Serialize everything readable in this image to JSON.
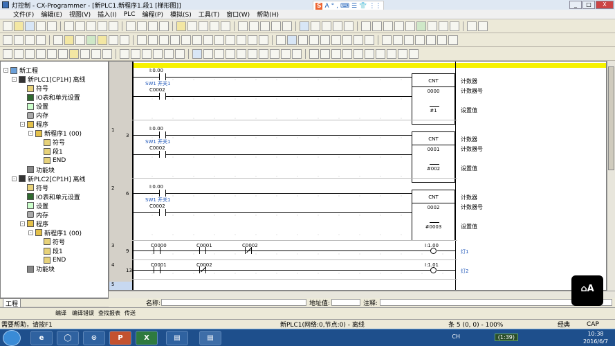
{
  "window": {
    "title": "灯控制 - CX-Programmer - [新PLC1.新程序1.段1 [梯形图]]",
    "controls": [
      "_",
      "□",
      "X"
    ]
  },
  "ime": {
    "logo": "S",
    "items": [
      "A",
      "°",
      ",",
      "⌨",
      "☰",
      "👕",
      "⋮⋮"
    ]
  },
  "menu": {
    "items": [
      "文件(F)",
      "编辑(E)",
      "视图(V)",
      "插入(I)",
      "PLC",
      "编程(P)",
      "模拟(S)",
      "工具(T)",
      "窗口(W)",
      "帮助(H)"
    ]
  },
  "tree": {
    "nodes": [
      {
        "label": "新工程",
        "icon": "project-icon",
        "level": 0,
        "expander": "-"
      },
      {
        "label": "新PLC1[CP1H] 离线",
        "icon": "plc-icon",
        "level": 1,
        "expander": "-"
      },
      {
        "label": "符号",
        "icon": "symbol-icon",
        "level": 2,
        "expander": ""
      },
      {
        "label": "IO表和单元设置",
        "icon": "io-table-icon",
        "level": 2,
        "expander": ""
      },
      {
        "label": "设置",
        "icon": "settings-icon",
        "level": 2,
        "expander": ""
      },
      {
        "label": "内存",
        "icon": "memory-icon",
        "level": 2,
        "expander": ""
      },
      {
        "label": "程序",
        "icon": "program-icon",
        "level": 2,
        "expander": "-"
      },
      {
        "label": "新程序1 (00)",
        "icon": "program-icon",
        "level": 3,
        "expander": "-"
      },
      {
        "label": "符号",
        "icon": "symbol-icon",
        "level": 4,
        "expander": ""
      },
      {
        "label": "段1",
        "icon": "section-icon",
        "level": 4,
        "expander": ""
      },
      {
        "label": "END",
        "icon": "section-icon",
        "level": 4,
        "expander": ""
      },
      {
        "label": "功能块",
        "icon": "function-block-icon",
        "level": 2,
        "expander": ""
      },
      {
        "label": "新PLC2[CP1H] 离线",
        "icon": "plc-icon",
        "level": 1,
        "expander": "-"
      },
      {
        "label": "符号",
        "icon": "symbol-icon",
        "level": 2,
        "expander": ""
      },
      {
        "label": "IO表和单元设置",
        "icon": "io-table-icon",
        "level": 2,
        "expander": ""
      },
      {
        "label": "设置",
        "icon": "settings-icon",
        "level": 2,
        "expander": ""
      },
      {
        "label": "内存",
        "icon": "memory-icon",
        "level": 2,
        "expander": ""
      },
      {
        "label": "程序",
        "icon": "program-icon",
        "level": 2,
        "expander": "-"
      },
      {
        "label": "新程序1 (00)",
        "icon": "program-icon",
        "level": 3,
        "expander": "-"
      },
      {
        "label": "符号",
        "icon": "symbol-icon",
        "level": 4,
        "expander": ""
      },
      {
        "label": "段1",
        "icon": "section-icon",
        "level": 4,
        "expander": ""
      },
      {
        "label": "END",
        "icon": "section-icon",
        "level": 4,
        "expander": ""
      },
      {
        "label": "功能块",
        "icon": "function-block-icon",
        "level": 2,
        "expander": ""
      }
    ],
    "tab_label": "工程"
  },
  "ladder": {
    "rungs": [
      {
        "rung": "",
        "step": "",
        "contact1_addr": "I:0.00",
        "contact1_comment": "SW1 开关1",
        "contact2_addr": "C0002",
        "block_name": "CNT",
        "block_num": "0000",
        "block_set": "#1",
        "label_counter": "计数器",
        "label_counter_no": "计数器号",
        "label_set": "设置值"
      },
      {
        "rung": "1",
        "step": "3",
        "contact1_addr": "I:0.00",
        "contact1_comment": "SW1 开关1",
        "contact2_addr": "C0002",
        "block_name": "CNT",
        "block_num": "0001",
        "block_set": "#002",
        "label_counter": "计数器",
        "label_counter_no": "计数器号",
        "label_set": "设置值"
      },
      {
        "rung": "2",
        "step": "6",
        "contact1_addr": "I:0.00",
        "contact1_comment": "SW1 开关1",
        "contact2_addr": "C0002",
        "block_name": "CNT",
        "block_num": "0002",
        "block_set": "#0003",
        "label_counter": "计数器",
        "label_counter_no": "计数器号",
        "label_set": "设置值"
      }
    ],
    "rung3": {
      "rung": "3",
      "step": "9",
      "c1": "C0000",
      "c2": "C0001",
      "c3": "C0002",
      "coil_addr": "I:1.00",
      "coil_comment": "灯1"
    },
    "rung4": {
      "rung": "4",
      "step": "13",
      "c1": "C0001",
      "c2": "C0002",
      "coil_addr": "I:1.01",
      "coil_comment": "灯2"
    },
    "rung5": {
      "rung": "5"
    }
  },
  "infobar": {
    "name_label": "名称:",
    "address_label": "地址值:",
    "comment_label": "注释:"
  },
  "output_tabs": [
    "编译",
    "编译错误",
    "查找报表",
    "传送"
  ],
  "status": {
    "help": "需要帮助，请按F1",
    "network": "新PLC1(网络:0,节点:0) - 离线",
    "position": "条 5 (0, 0)  - 100%",
    "mode": "经典",
    "caps": "CAP"
  },
  "taskbar": {
    "apps": [
      "e",
      "◯",
      "⊙",
      "P",
      "X",
      "▤",
      "▤"
    ],
    "tray": "CH",
    "timer": "(1:39)",
    "time": "10:38",
    "date": "2016/6/7"
  },
  "colors": {
    "selection": "#f7f200",
    "comment": "#1d55b8",
    "taskbar": "#1e4f8c"
  }
}
